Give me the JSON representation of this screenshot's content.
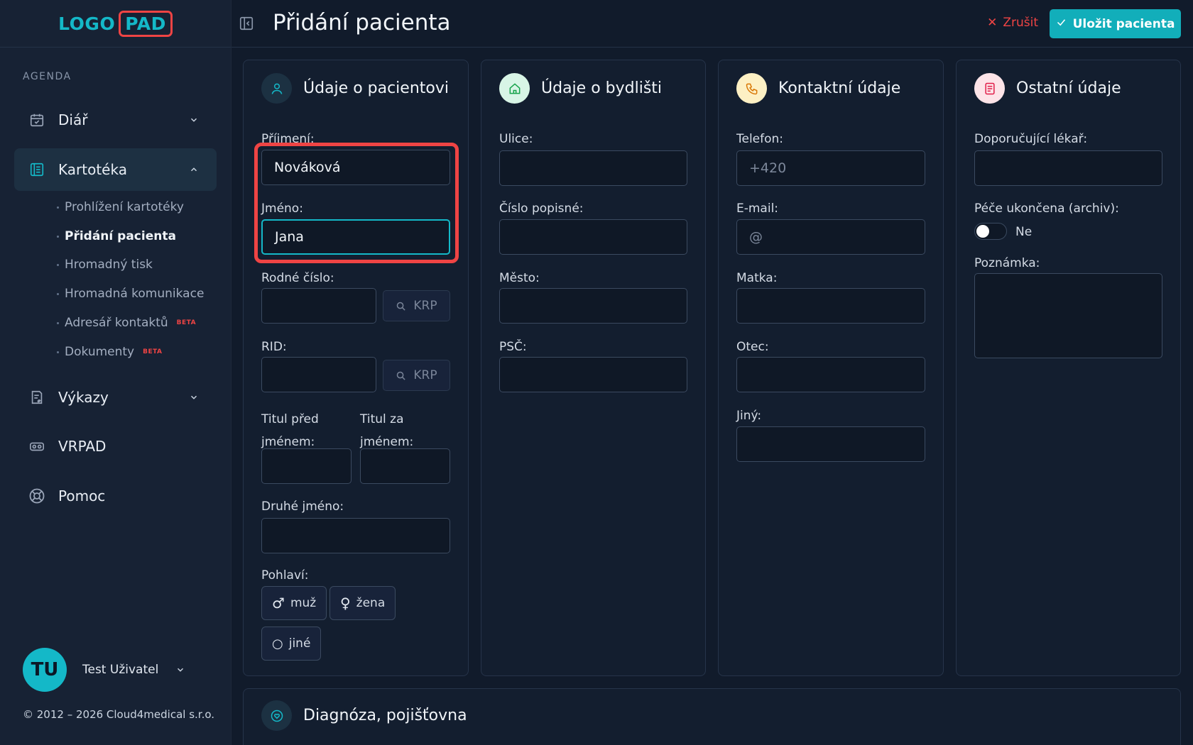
{
  "logo": {
    "left": "LOGO",
    "right": "PAD"
  },
  "sidebar": {
    "section": "AGENDA",
    "items": [
      {
        "label": "Diář",
        "icon": "calendar-icon"
      },
      {
        "label": "Kartotéka",
        "icon": "folder-icon"
      },
      {
        "label": "Výkazy",
        "icon": "report-icon"
      },
      {
        "label": "VRPAD",
        "icon": "vr-icon"
      },
      {
        "label": "Pomoc",
        "icon": "help-icon"
      }
    ],
    "subitems": [
      {
        "label": "Prohlížení kartotéky"
      },
      {
        "label": "Přidání pacienta"
      },
      {
        "label": "Hromadný tisk"
      },
      {
        "label": "Hromadná komunikace"
      },
      {
        "label": "Adresář kontaktů",
        "badge": "BETA"
      },
      {
        "label": "Dokumenty",
        "badge": "BETA"
      }
    ],
    "user": {
      "initials": "TU",
      "name": "Test Uživatel"
    },
    "copyright": "© 2012 – 2026 Cloud4medical s.r.o."
  },
  "header": {
    "title": "Přidání pacienta",
    "cancel": "Zrušit",
    "save": "Uložit pacienta"
  },
  "patient": {
    "title": "Údaje o pacientovi",
    "surname_label": "Příjmení:",
    "surname_value": "Nováková",
    "name_label": "Jméno:",
    "name_value": "Jana",
    "birth_label": "Rodné číslo:",
    "rid_label": "RID:",
    "krp": "KRP",
    "title_before_label": "Titul před jménem:",
    "title_after_label": "Titul za jménem:",
    "middle_label": "Druhé jméno:",
    "gender_label": "Pohlaví:",
    "gender_male": "muž",
    "gender_female": "žena",
    "gender_other": "jiné"
  },
  "address": {
    "title": "Údaje o bydlišti",
    "street": "Ulice:",
    "number": "Číslo popisné:",
    "city": "Město:",
    "zip": "PSČ:"
  },
  "contact": {
    "title": "Kontaktní údaje",
    "phone_label": "Telefon:",
    "phone_placeholder": "+420",
    "email_label": "E-mail:",
    "email_placeholder": "@",
    "mother_label": "Matka:",
    "father_label": "Otec:",
    "other_label": "Jiný:"
  },
  "other": {
    "title": "Ostatní údaje",
    "doctor_label": "Doporučující lékař:",
    "archive_label": "Péče ukončena (archiv):",
    "archive_value": "Ne",
    "note_label": "Poznámka:"
  },
  "diagnosis": {
    "title": "Diagnóza, pojišťovna"
  },
  "colors": {
    "accent": "#14b8c8",
    "danger": "#ef4444",
    "background": "#111b2b"
  }
}
